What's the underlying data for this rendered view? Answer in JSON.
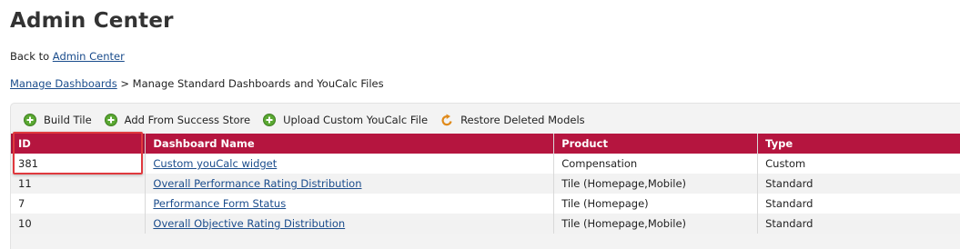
{
  "page": {
    "title": "Admin Center",
    "back_prefix": "Back to",
    "back_link": "Admin Center"
  },
  "breadcrumb": {
    "link": "Manage Dashboards",
    "separator": ">",
    "current": "Manage Standard Dashboards and YouCalc Files"
  },
  "toolbar": {
    "build_tile": "Build Tile",
    "add_success_store": "Add From Success Store",
    "upload_youcalc": "Upload Custom YouCalc File",
    "restore_models": "Restore Deleted Models"
  },
  "table": {
    "headers": [
      "ID",
      "Dashboard Name",
      "Product",
      "Type"
    ],
    "rows": [
      {
        "id": "381",
        "name": "Custom youCalc widget",
        "product": "Compensation",
        "type": "Custom"
      },
      {
        "id": "11",
        "name": "Overall Performance Rating Distribution",
        "product": "Tile (Homepage,Mobile)",
        "type": "Standard"
      },
      {
        "id": "7",
        "name": "Performance Form Status",
        "product": "Tile (Homepage)",
        "type": "Standard"
      },
      {
        "id": "10",
        "name": "Overall Objective Rating Distribution",
        "product": "Tile (Homepage,Mobile)",
        "type": "Standard"
      }
    ]
  },
  "colors": {
    "header_bg": "#b5153f",
    "link": "#1a4c8c",
    "add_icon": "#5aa832",
    "restore_icon": "#e08a1a",
    "highlight": "#e0393e"
  }
}
